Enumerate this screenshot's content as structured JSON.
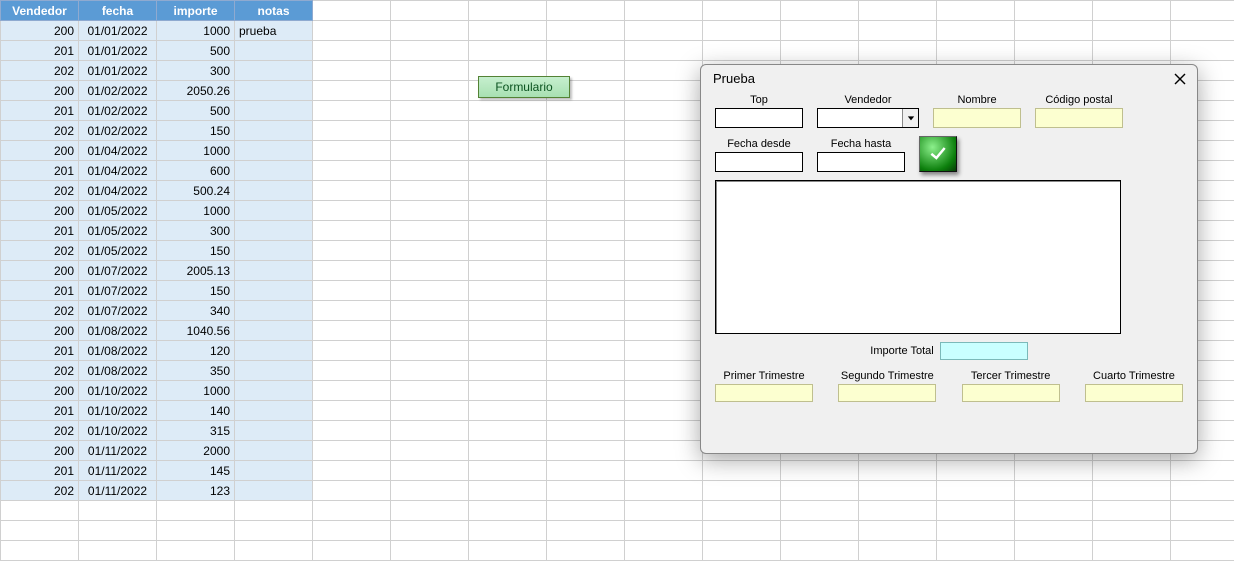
{
  "headers": [
    "Vendedor",
    "fecha",
    "importe",
    "notas"
  ],
  "rows": [
    {
      "v": "200",
      "f": "01/01/2022",
      "i": "1000",
      "n": "prueba"
    },
    {
      "v": "201",
      "f": "01/01/2022",
      "i": "500",
      "n": ""
    },
    {
      "v": "202",
      "f": "01/01/2022",
      "i": "300",
      "n": ""
    },
    {
      "v": "200",
      "f": "01/02/2022",
      "i": "2050.26",
      "n": ""
    },
    {
      "v": "201",
      "f": "01/02/2022",
      "i": "500",
      "n": ""
    },
    {
      "v": "202",
      "f": "01/02/2022",
      "i": "150",
      "n": ""
    },
    {
      "v": "200",
      "f": "01/04/2022",
      "i": "1000",
      "n": ""
    },
    {
      "v": "201",
      "f": "01/04/2022",
      "i": "600",
      "n": ""
    },
    {
      "v": "202",
      "f": "01/04/2022",
      "i": "500.24",
      "n": ""
    },
    {
      "v": "200",
      "f": "01/05/2022",
      "i": "1000",
      "n": ""
    },
    {
      "v": "201",
      "f": "01/05/2022",
      "i": "300",
      "n": ""
    },
    {
      "v": "202",
      "f": "01/05/2022",
      "i": "150",
      "n": ""
    },
    {
      "v": "200",
      "f": "01/07/2022",
      "i": "2005.13",
      "n": ""
    },
    {
      "v": "201",
      "f": "01/07/2022",
      "i": "150",
      "n": ""
    },
    {
      "v": "202",
      "f": "01/07/2022",
      "i": "340",
      "n": ""
    },
    {
      "v": "200",
      "f": "01/08/2022",
      "i": "1040.56",
      "n": ""
    },
    {
      "v": "201",
      "f": "01/08/2022",
      "i": "120",
      "n": ""
    },
    {
      "v": "202",
      "f": "01/08/2022",
      "i": "350",
      "n": ""
    },
    {
      "v": "200",
      "f": "01/10/2022",
      "i": "1000",
      "n": ""
    },
    {
      "v": "201",
      "f": "01/10/2022",
      "i": "140",
      "n": ""
    },
    {
      "v": "202",
      "f": "01/10/2022",
      "i": "315",
      "n": ""
    },
    {
      "v": "200",
      "f": "01/11/2022",
      "i": "2000",
      "n": ""
    },
    {
      "v": "201",
      "f": "01/11/2022",
      "i": "145",
      "n": ""
    },
    {
      "v": "202",
      "f": "01/11/2022",
      "i": "123",
      "n": ""
    }
  ],
  "form_button": "Formulario",
  "dialog": {
    "title": "Prueba",
    "labels": {
      "top": "Top",
      "vendedor": "Vendedor",
      "nombre": "Nombre",
      "codigo_postal": "Código postal",
      "fecha_desde": "Fecha desde",
      "fecha_hasta": "Fecha hasta",
      "importe_total": "Importe Total",
      "t1": "Primer Trimestre",
      "t2": "Segundo Trimestre",
      "t3": "Tercer Trimestre",
      "t4": "Cuarto Trimestre"
    },
    "values": {
      "top": "",
      "vendedor": "",
      "nombre": "",
      "codigo_postal": "",
      "fecha_desde": "",
      "fecha_hasta": "",
      "importe_total": "",
      "t1": "",
      "t2": "",
      "t3": "",
      "t4": ""
    }
  }
}
